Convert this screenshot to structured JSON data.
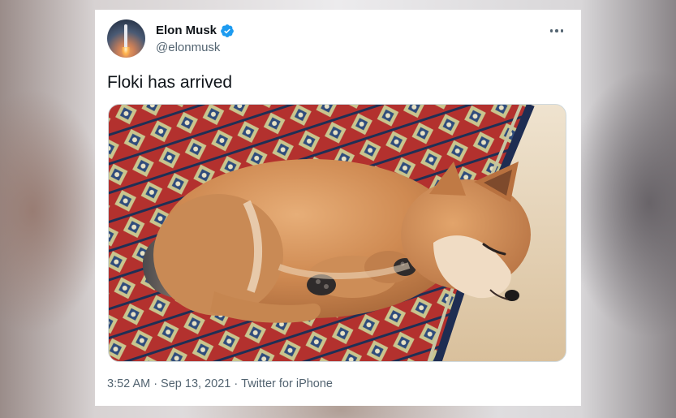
{
  "tweet": {
    "author": {
      "display_name": "Elon Musk",
      "handle": "@elonmusk",
      "verified": true,
      "avatar_icon": "rocket-launch-avatar"
    },
    "more_icon": "more-horizontal-icon",
    "text": "Floki has arrived",
    "media": {
      "kind": "photo",
      "subject": "sleeping shiba inu puppy on a patterned rug"
    },
    "meta": {
      "time": "3:52 AM",
      "separator": "·",
      "date": "Sep 13, 2021",
      "client": "Twitter for iPhone"
    }
  },
  "colors": {
    "card_bg": "#ffffff",
    "text_primary": "#0f1419",
    "text_secondary": "#536471",
    "verified_blue": "#1d9bf0"
  }
}
